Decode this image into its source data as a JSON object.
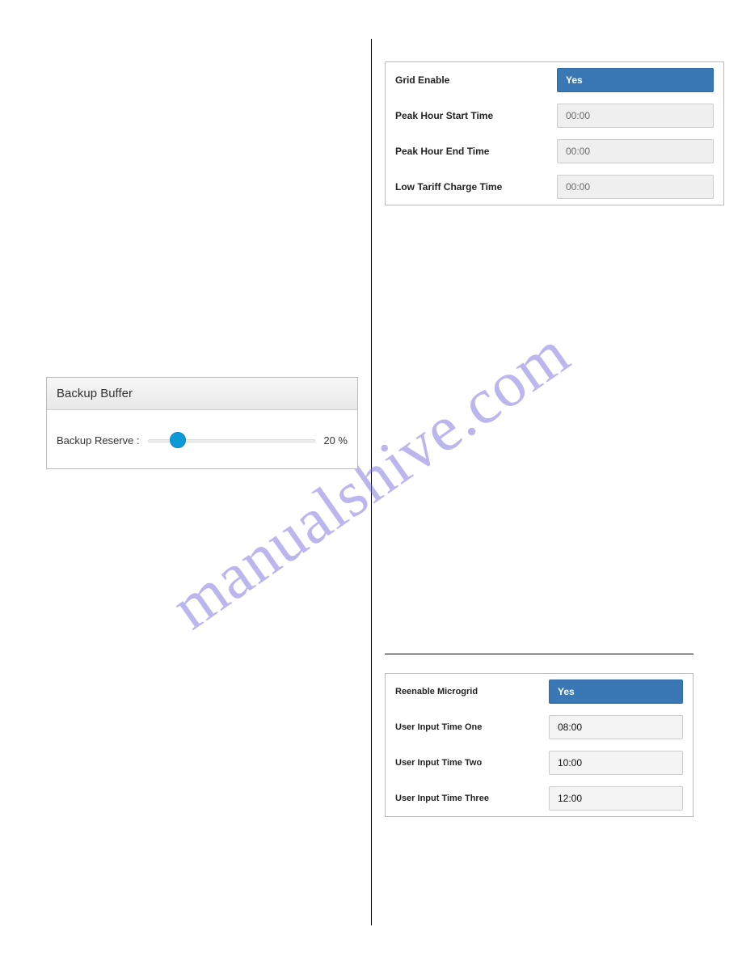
{
  "watermark": "manualshive.com",
  "grid_panel": {
    "rows": [
      {
        "label": "Grid Enable",
        "type": "select",
        "value": "Yes"
      },
      {
        "label": "Peak Hour Start Time",
        "type": "time",
        "value": "00:00"
      },
      {
        "label": "Peak Hour End Time",
        "type": "time",
        "value": "00:00"
      },
      {
        "label": "Low Tariff Charge Time",
        "type": "time",
        "value": "00:00"
      }
    ]
  },
  "backup_panel": {
    "title": "Backup Buffer",
    "label": "Backup Reserve :",
    "value_text": "20 %",
    "value_percent": 20
  },
  "micro_panel": {
    "rows": [
      {
        "label": "Reenable Microgrid",
        "type": "select",
        "value": "Yes"
      },
      {
        "label": "User Input Time One",
        "type": "time",
        "value": "08:00"
      },
      {
        "label": "User Input Time Two",
        "type": "time",
        "value": "10:00"
      },
      {
        "label": "User Input Time Three",
        "type": "time",
        "value": "12:00"
      }
    ]
  }
}
